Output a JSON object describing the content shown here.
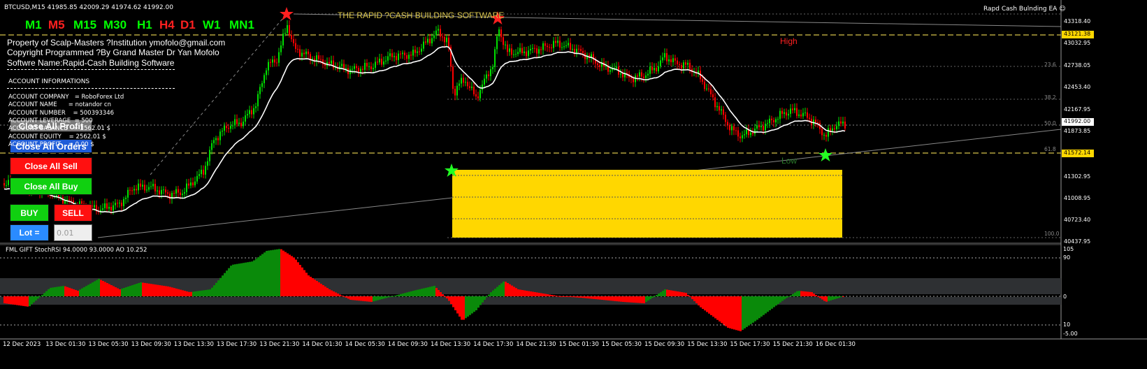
{
  "header": {
    "symbol_info": "BTCUSD,M15  41985.85 42009.29 41974.62 41992.00",
    "ea_label": "Rapd Cash Bulnding EA ☺",
    "software_title": "THE RAPID ?CASH BUILDING SOFTWARE"
  },
  "timeframes": [
    {
      "label": "M1",
      "color": "#00ff00"
    },
    {
      "label": "M5",
      "color": "#ff2020"
    },
    {
      "label": "M15",
      "color": "#00ff00"
    },
    {
      "label": "M30",
      "color": "#00ff00"
    },
    {
      "label": "H1",
      "color": "#00ff00"
    },
    {
      "label": "H4",
      "color": "#ff2020"
    },
    {
      "label": "D1",
      "color": "#ff2020"
    },
    {
      "label": "W1",
      "color": "#00ff00"
    },
    {
      "label": "MN1",
      "color": "#00ff00"
    }
  ],
  "info": {
    "property": "Property of Scalp-Masters ?Institution ymofolo@gmail.com",
    "copyright": "Copyright Programmed ?By Grand Master Dr Yan Mofolo",
    "software_name": "Softwre Name:Rapid-Cash Building Software",
    "account_header": "ACCOUNT INFORMATIONS",
    "account_rows": [
      "ACCOUNT COMPANY   = RoboForex Ltd",
      "ACCOUNT NAME      = notandor cn",
      "ACCOUNT NUMBER    = 500393346",
      "ACCOUNT LEVERAGE  = 500",
      "ACCOUNT BALANCE   = 2562.01 $",
      "ACCOUNT EQUITY    = 2562.01 $",
      "ACCOUNT PROFIT    = 0.00 $"
    ]
  },
  "buttons": {
    "close_all_profit": "Close All Profit",
    "close_all_orders": "Close All Orders",
    "close_all_sell": "Close All Sell",
    "close_all_buy": "Close All Buy",
    "buy": "BUY",
    "sell": "SELL",
    "lot_label": "Lot  =",
    "lot_value": "0.01"
  },
  "annotations": {
    "high": "High",
    "low": "Low"
  },
  "price_axis": [
    "43318.40",
    "43032.95",
    "42738.05",
    "42453.40",
    "42167.95",
    "41873.85",
    "41302.95",
    "41008.95",
    "40723.40",
    "40437.95"
  ],
  "price_markers": {
    "high_level": "43121.38",
    "current": "41992.00",
    "low_level": "41572.14"
  },
  "fib_labels": [
    "23.6",
    "38.2",
    "50.0",
    "61.8",
    "100.0"
  ],
  "indicator": {
    "title": "FML GIFT StochRSI 94.0000 93.0000  AO 10.252",
    "levels": [
      "105",
      "90",
      "0",
      "10",
      "-5.00"
    ]
  },
  "time_axis": [
    "12 Dec 2023",
    "13 Dec 01:30",
    "13 Dec 05:30",
    "13 Dec 09:30",
    "13 Dec 13:30",
    "13 Dec 17:30",
    "13 Dec 21:30",
    "14 Dec 01:30",
    "14 Dec 05:30",
    "14 Dec 09:30",
    "14 Dec 13:30",
    "14 Dec 17:30",
    "14 Dec 21:30",
    "15 Dec 01:30",
    "15 Dec 05:30",
    "15 Dec 09:30",
    "15 Dec 13:30",
    "15 Dec 17:30",
    "15 Dec 21:30",
    "16 Dec 01:30"
  ],
  "colors": {
    "bull": "#00e000",
    "bear": "#ff0000",
    "ma": "#ffffff",
    "zone": "#ffd700",
    "guide": "#d7c34a"
  }
}
